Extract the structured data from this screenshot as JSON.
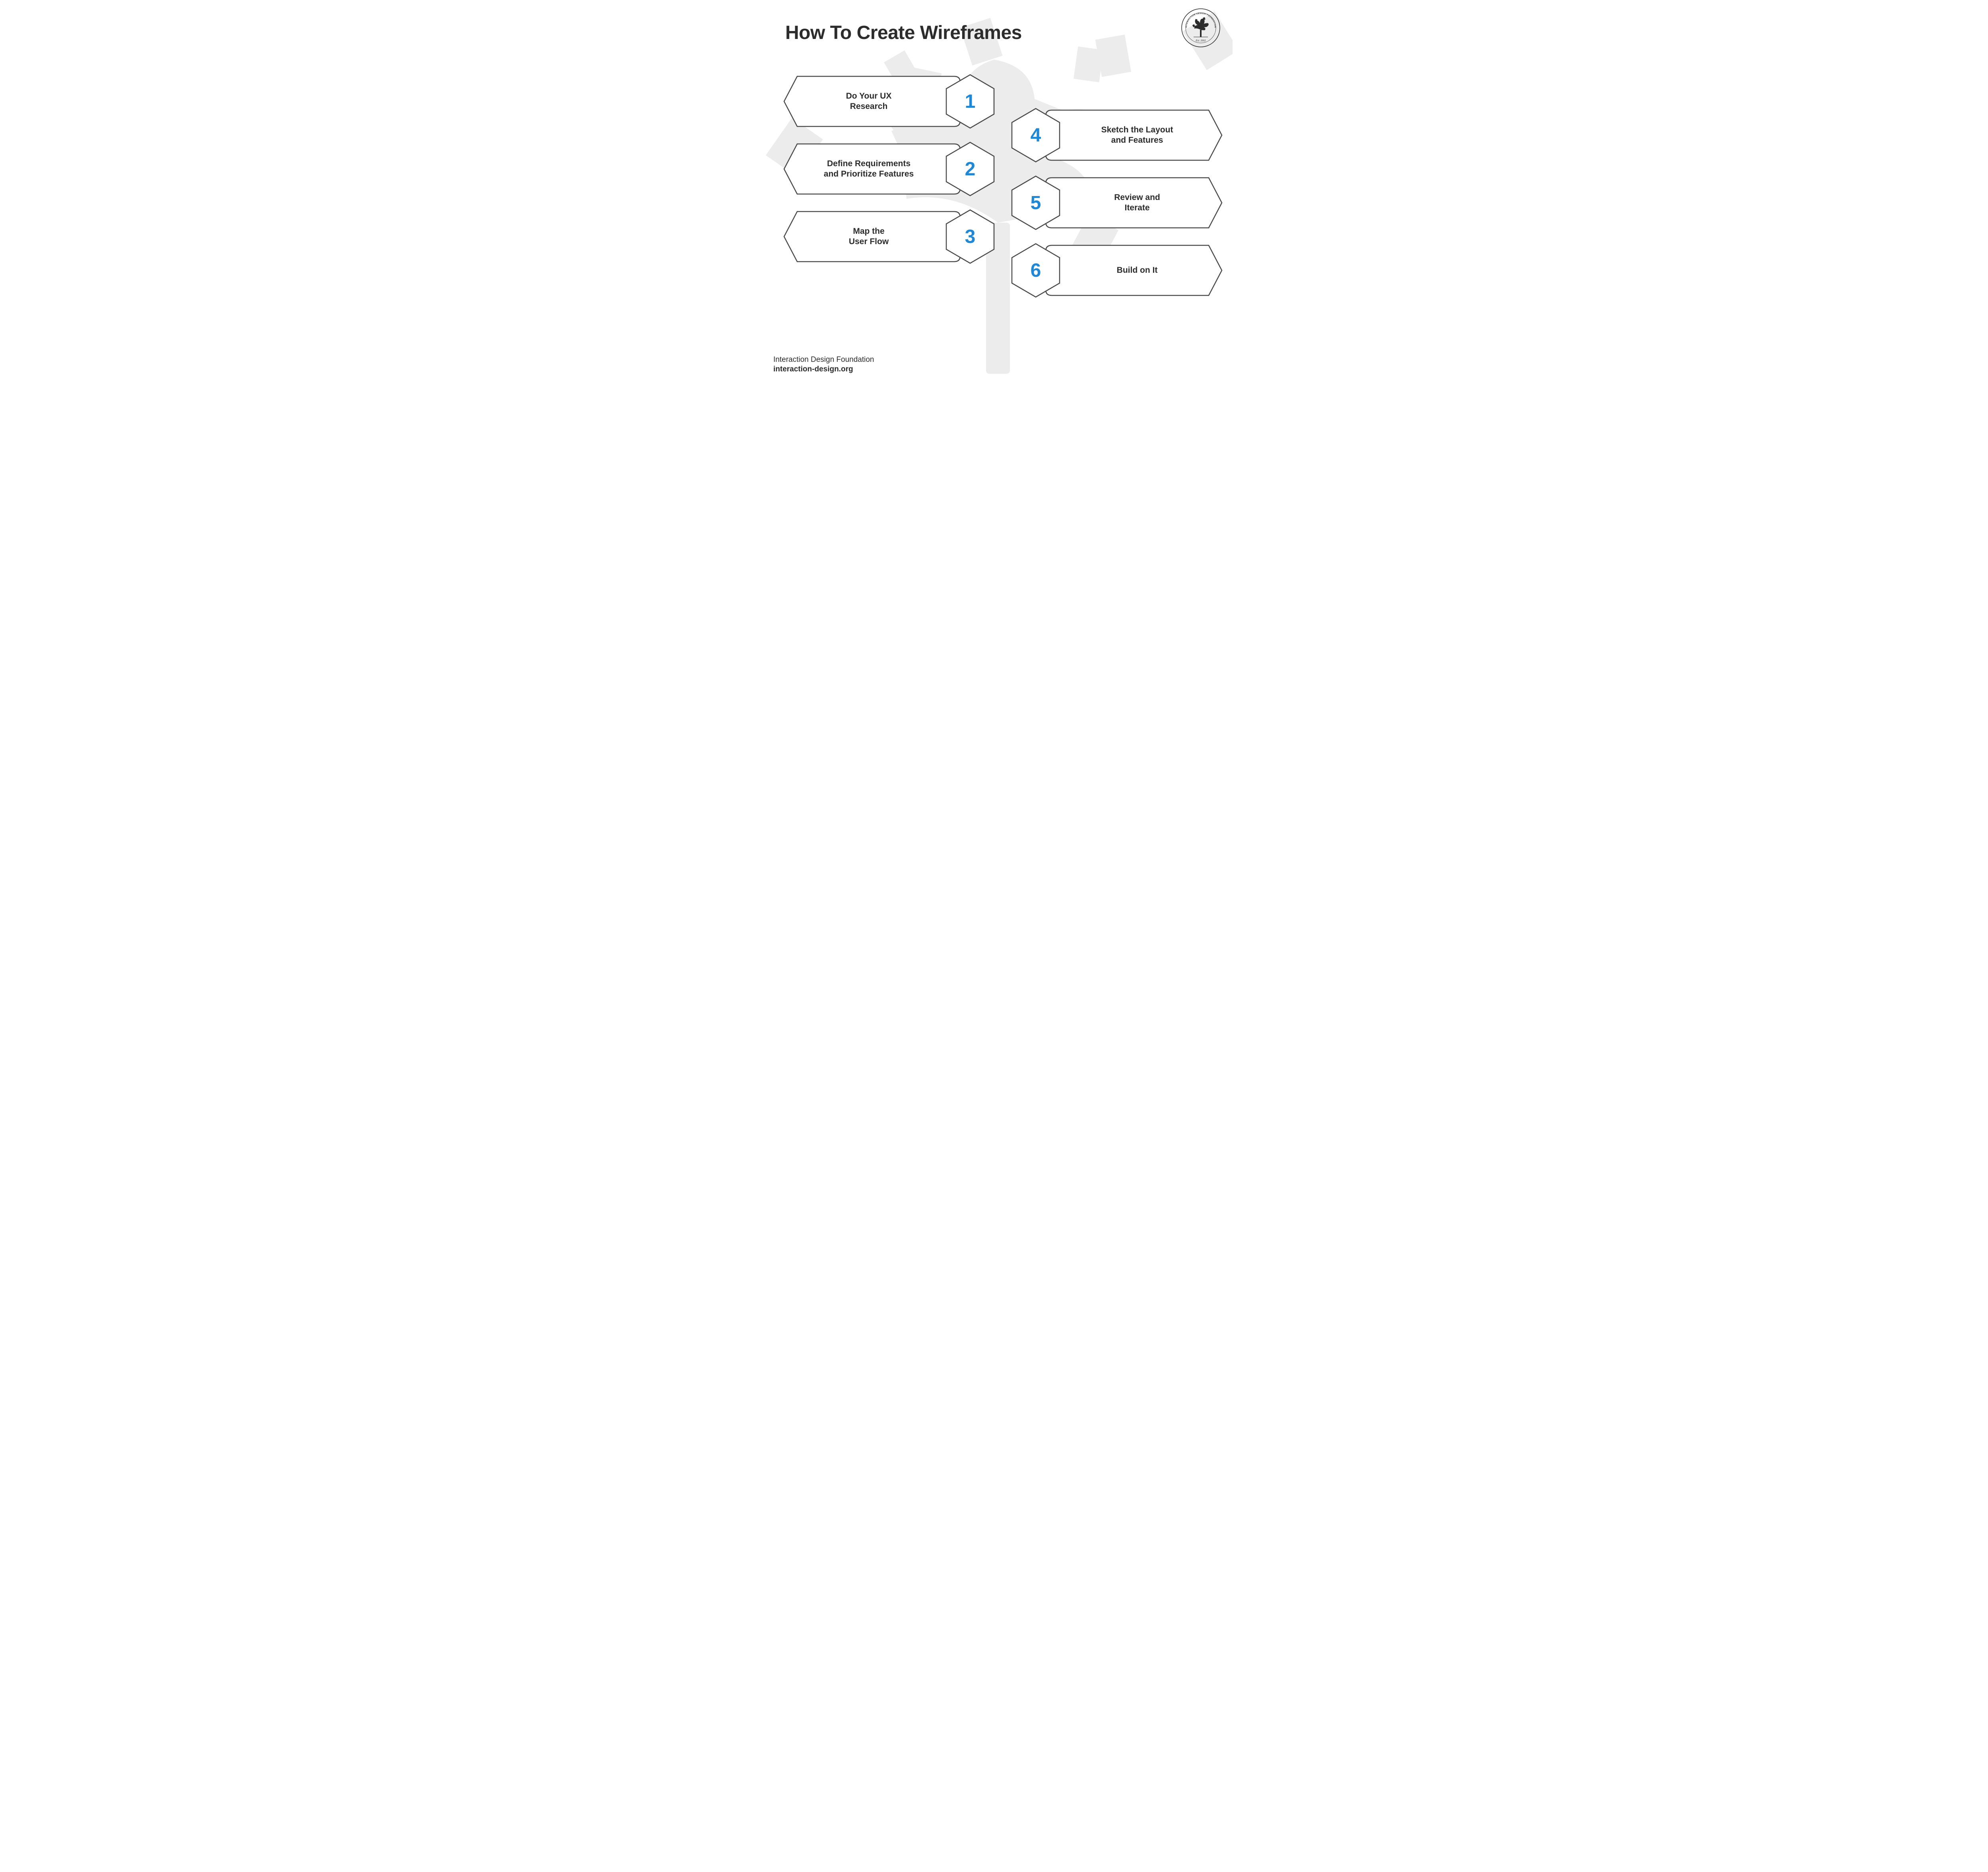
{
  "title": "How To Create Wireframes",
  "logo": {
    "ring_top": "INTERACTION DESIGN FOUNDATION",
    "est": "Est. 2002"
  },
  "steps": [
    {
      "num": "1",
      "line1": "Do Your UX",
      "line2": "Research",
      "side": "left"
    },
    {
      "num": "2",
      "line1": "Define Requirements",
      "line2": "and Prioritize Features",
      "side": "left"
    },
    {
      "num": "3",
      "line1": "Map the",
      "line2": "User Flow",
      "side": "left"
    },
    {
      "num": "4",
      "line1": "Sketch the Layout",
      "line2": "and Features",
      "side": "right"
    },
    {
      "num": "5",
      "line1": "Review and",
      "line2": "Iterate",
      "side": "right"
    },
    {
      "num": "6",
      "line1": "Build on It",
      "line2": "",
      "side": "right"
    }
  ],
  "footer": {
    "org": "Interaction Design Foundation",
    "url": "interaction-design.org"
  },
  "colors": {
    "stroke": "#4a4a4a",
    "accent": "#1e88d6",
    "text": "#2c2c2c"
  }
}
